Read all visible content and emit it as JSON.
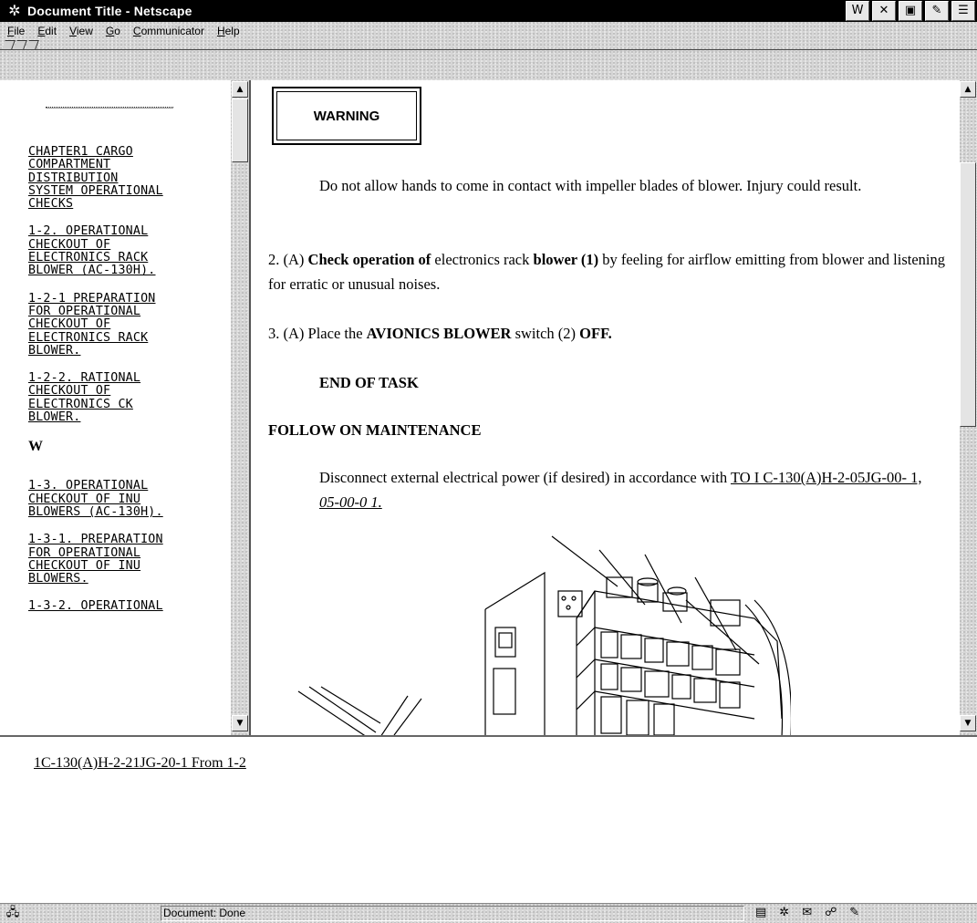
{
  "window": {
    "title": "Document Title - Netscape",
    "app_icon": "netscape-icon",
    "controls": [
      "W",
      "✕",
      "▣",
      "✎",
      "☰"
    ]
  },
  "menu": {
    "items": [
      "File",
      "Edit",
      "View",
      "Go",
      "Communicator",
      "Help"
    ]
  },
  "toc": {
    "items": [
      "CHAPTER1 CARGO\nCOMPARTMENT\nDISTRIBUTION\nSYSTEM OPERATIONAL\nCHECKS",
      "1-2. OPERATIONAL\nCHECKOUT OF\nELECTRONICS RACK\nBLOWER (AC-130H).",
      "1-2-1 PREPARATION\nFOR OPERATIONAL\nCHECKOUT OF\nELECTRONICS RACK\nBLOWER.",
      "1-2-2. RATIONAL\nCHECKOUT OF\nELECTRONICS CK\nBLOWER."
    ],
    "letter": "W",
    "items2": [
      "1-3. OPERATIONAL\nCHECKOUT OF INU\nBLOWERS (AC-130H).",
      "1-3-1. PREPARATION\nFOR OPERATIONAL\nCHECKOUT OF INU\nBLOWERS.",
      "1-3-2. OPERATIONAL"
    ]
  },
  "main": {
    "warning_label": "WARNING",
    "warning_text": "Do not allow hands to come in contact with impeller blades of blower. Injury could result.",
    "step2_prefix": "2. (A) ",
    "step2_bold1": "Check operation of",
    "step2_mid": " electronics rack ",
    "step2_bold2": "blower (1)",
    "step2_rest": " by feeling for airflow emitting from blower and listening for erratic or unusual noises.",
    "step3_prefix": "3. (A) Place the ",
    "step3_bold1": "AVIONICS BLOWER",
    "step3_mid": " switch (2) ",
    "step3_bold2": "OFF.",
    "end_of_task": "END OF TASK",
    "follow_on_heading": "FOLLOW ON MAINTENANCE",
    "follow_on_text": "Disconnect external electrical power (if desired) in accordance with ",
    "follow_on_link": "TO I C-130(A)H-2-05JG-00- 1, ",
    "follow_on_link_italic": "05-00-0 1."
  },
  "bottom": {
    "from_link": "1C-130(A)H-2-21JG-20-1 From 1-2"
  },
  "status": {
    "text": "Document: Done",
    "left_icon": "security-lock-icon",
    "right_icons": [
      "component-bar-icon",
      "navigator-icon",
      "mail-icon",
      "discussion-icon",
      "composer-icon"
    ]
  }
}
